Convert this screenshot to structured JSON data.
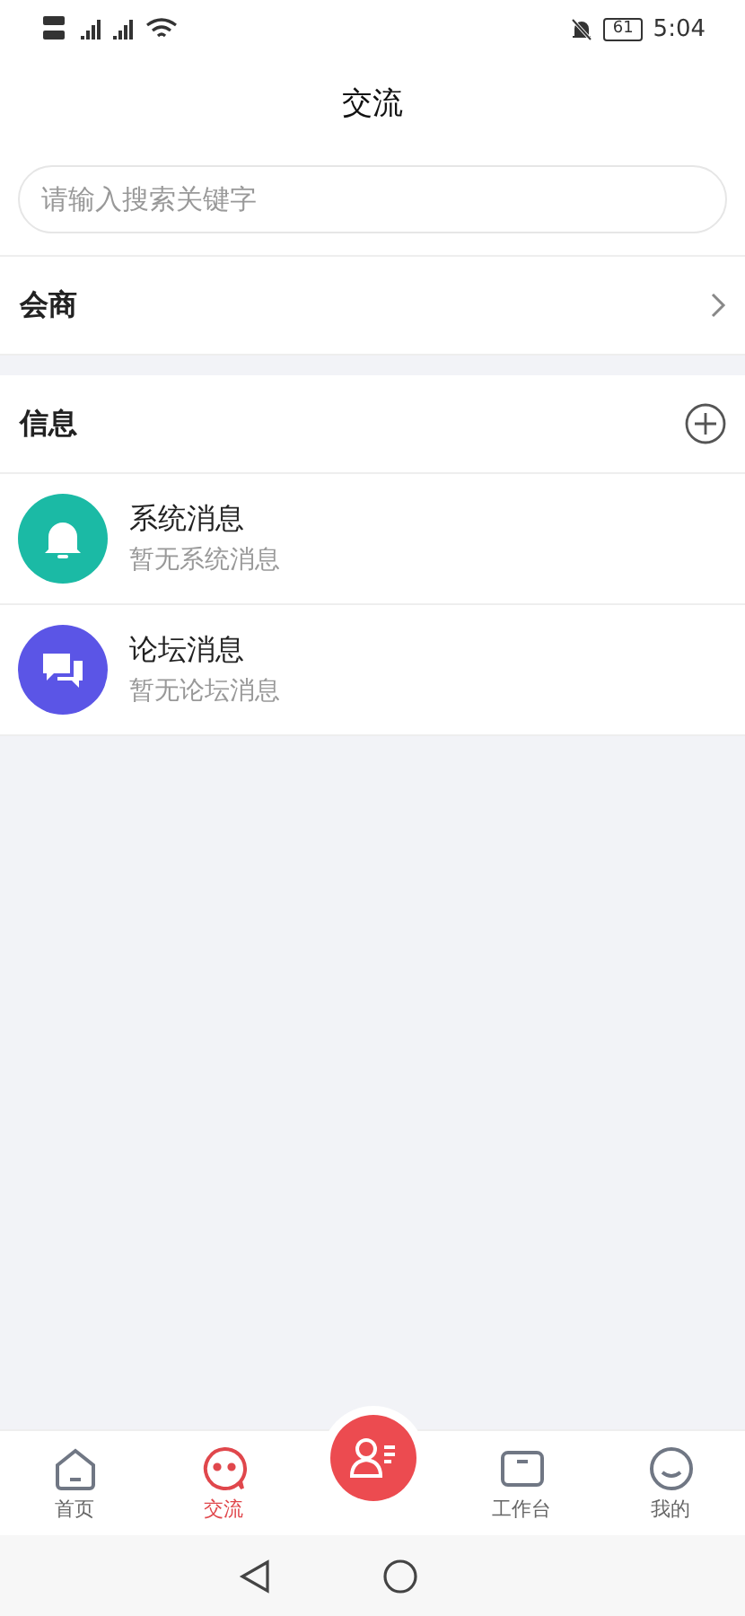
{
  "status_bar": {
    "time": "5:04",
    "battery": "61"
  },
  "header": {
    "title": "交流"
  },
  "search": {
    "placeholder": "请输入搜索关键字"
  },
  "sections": [
    {
      "kind": "link",
      "title": "会商"
    },
    {
      "kind": "add",
      "title": "信息"
    }
  ],
  "messages": [
    {
      "title": "系统消息",
      "subtitle": "暂无系统消息",
      "color": "#1bbaa5",
      "kind": "bell"
    },
    {
      "title": "论坛消息",
      "subtitle": "暂无论坛消息",
      "color": "#5b55e6",
      "kind": "chat"
    }
  ],
  "tab_bar": [
    {
      "kind": "home",
      "label": "首页",
      "selected": false
    },
    {
      "kind": "chat",
      "label": "交流",
      "selected": true
    },
    {
      "kind": "center",
      "selected": false
    },
    {
      "kind": "desk",
      "label": "工作台",
      "selected": false
    },
    {
      "kind": "face",
      "label": "我的",
      "selected": false
    }
  ]
}
